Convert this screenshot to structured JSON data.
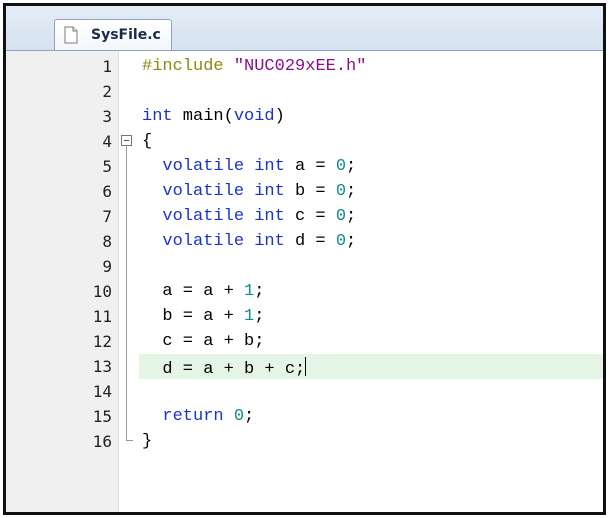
{
  "tab": {
    "filename": "SysFile.c"
  },
  "icons": {
    "file": "c-file-icon",
    "fold": "fold-collapse-icon"
  },
  "colors": {
    "preprocessor": "#8b8b10",
    "keyword": "#1a34c8",
    "string": "#8a0f8a",
    "number": "#0f8f8a",
    "current_line_bg": "#e5f5e5"
  },
  "editor": {
    "current_line": 13,
    "lines": [
      {
        "num": "1",
        "tokens": [
          {
            "t": "pp",
            "v": "#include "
          },
          {
            "t": "str",
            "v": "\"NUC029xEE.h\""
          }
        ]
      },
      {
        "num": "2",
        "tokens": []
      },
      {
        "num": "3",
        "tokens": [
          {
            "t": "kw",
            "v": "int"
          },
          {
            "t": "op",
            "v": " main("
          },
          {
            "t": "kw",
            "v": "void"
          },
          {
            "t": "op",
            "v": ")"
          }
        ]
      },
      {
        "num": "4",
        "tokens": [
          {
            "t": "op",
            "v": "{"
          }
        ]
      },
      {
        "num": "5",
        "tokens": [
          {
            "t": "op",
            "v": "  "
          },
          {
            "t": "kw",
            "v": "volatile int"
          },
          {
            "t": "op",
            "v": " a = "
          },
          {
            "t": "num",
            "v": "0"
          },
          {
            "t": "op",
            "v": ";"
          }
        ]
      },
      {
        "num": "6",
        "tokens": [
          {
            "t": "op",
            "v": "  "
          },
          {
            "t": "kw",
            "v": "volatile int"
          },
          {
            "t": "op",
            "v": " b = "
          },
          {
            "t": "num",
            "v": "0"
          },
          {
            "t": "op",
            "v": ";"
          }
        ]
      },
      {
        "num": "7",
        "tokens": [
          {
            "t": "op",
            "v": "  "
          },
          {
            "t": "kw",
            "v": "volatile int"
          },
          {
            "t": "op",
            "v": " c = "
          },
          {
            "t": "num",
            "v": "0"
          },
          {
            "t": "op",
            "v": ";"
          }
        ]
      },
      {
        "num": "8",
        "tokens": [
          {
            "t": "op",
            "v": "  "
          },
          {
            "t": "kw",
            "v": "volatile int"
          },
          {
            "t": "op",
            "v": " d = "
          },
          {
            "t": "num",
            "v": "0"
          },
          {
            "t": "op",
            "v": ";"
          }
        ]
      },
      {
        "num": "9",
        "tokens": []
      },
      {
        "num": "10",
        "tokens": [
          {
            "t": "op",
            "v": "  a = a + "
          },
          {
            "t": "num",
            "v": "1"
          },
          {
            "t": "op",
            "v": ";"
          }
        ]
      },
      {
        "num": "11",
        "tokens": [
          {
            "t": "op",
            "v": "  b = a + "
          },
          {
            "t": "num",
            "v": "1"
          },
          {
            "t": "op",
            "v": ";"
          }
        ]
      },
      {
        "num": "12",
        "tokens": [
          {
            "t": "op",
            "v": "  c = a + b;"
          }
        ]
      },
      {
        "num": "13",
        "tokens": [
          {
            "t": "op",
            "v": "  d = a + b + c;"
          }
        ]
      },
      {
        "num": "14",
        "tokens": []
      },
      {
        "num": "15",
        "tokens": [
          {
            "t": "op",
            "v": "  "
          },
          {
            "t": "kw",
            "v": "return"
          },
          {
            "t": "op",
            "v": " "
          },
          {
            "t": "num",
            "v": "0"
          },
          {
            "t": "op",
            "v": ";"
          }
        ]
      },
      {
        "num": "16",
        "tokens": [
          {
            "t": "op",
            "v": "}"
          }
        ]
      }
    ]
  }
}
